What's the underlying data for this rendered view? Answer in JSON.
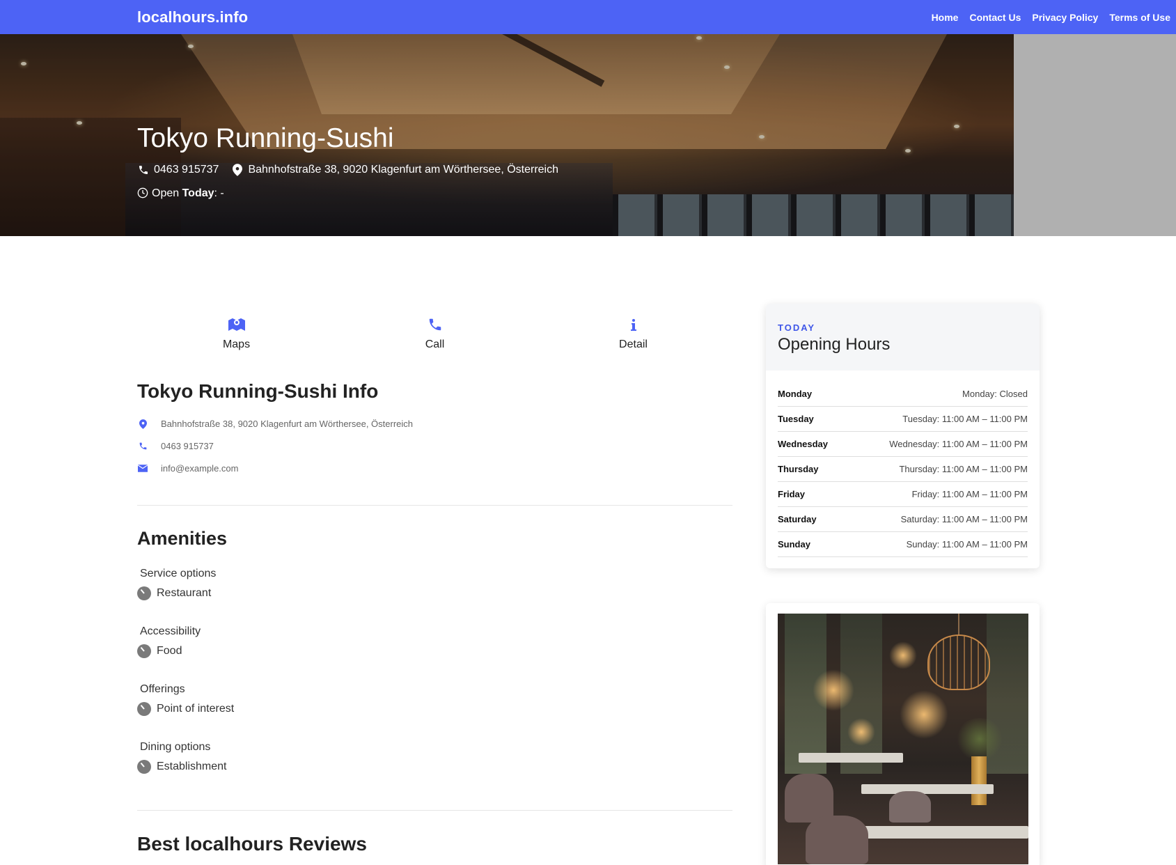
{
  "site": {
    "brand": "localhours.info",
    "nav": [
      "Home",
      "Contact Us",
      "Privacy Policy",
      "Terms of Use"
    ]
  },
  "hero": {
    "title": "Tokyo Running-Sushi",
    "phone": "0463 915737",
    "address": "Bahnhofstraße 38, 9020 Klagenfurt am Wörthersee, Österreich",
    "open_prefix": "Open",
    "open_today_label": "Today",
    "open_today_value": ": -"
  },
  "actions": [
    {
      "label": "Maps",
      "icon": "map-icon"
    },
    {
      "label": "Call",
      "icon": "phone-icon"
    },
    {
      "label": "Detail",
      "icon": "info-icon"
    }
  ],
  "info": {
    "title": "Tokyo Running-Sushi Info",
    "address": "Bahnhofstraße 38, 9020 Klagenfurt am Wörthersee, Österreich",
    "phone": "0463 915737",
    "email": "info@example.com"
  },
  "amenities": {
    "title": "Amenities",
    "groups": [
      {
        "category": "Service options",
        "item": "Restaurant"
      },
      {
        "category": "Accessibility",
        "item": "Food"
      },
      {
        "category": "Offerings",
        "item": "Point of interest"
      },
      {
        "category": "Dining options",
        "item": "Establishment"
      }
    ]
  },
  "reviews": {
    "title": "Best localhours Reviews"
  },
  "hours": {
    "eyebrow": "TODAY",
    "title": "Opening Hours",
    "rows": [
      {
        "day": "Monday",
        "value": "Monday: Closed"
      },
      {
        "day": "Tuesday",
        "value": "Tuesday: 11:00 AM – 11:00 PM"
      },
      {
        "day": "Wednesday",
        "value": "Wednesday: 11:00 AM – 11:00 PM"
      },
      {
        "day": "Thursday",
        "value": "Thursday: 11:00 AM – 11:00 PM"
      },
      {
        "day": "Friday",
        "value": "Friday: 11:00 AM – 11:00 PM"
      },
      {
        "day": "Saturday",
        "value": "Saturday: 11:00 AM – 11:00 PM"
      },
      {
        "day": "Sunday",
        "value": "Sunday: 11:00 AM – 11:00 PM"
      }
    ]
  },
  "colors": {
    "navbar": "#4d63f5",
    "accent": "#3f56e8"
  }
}
